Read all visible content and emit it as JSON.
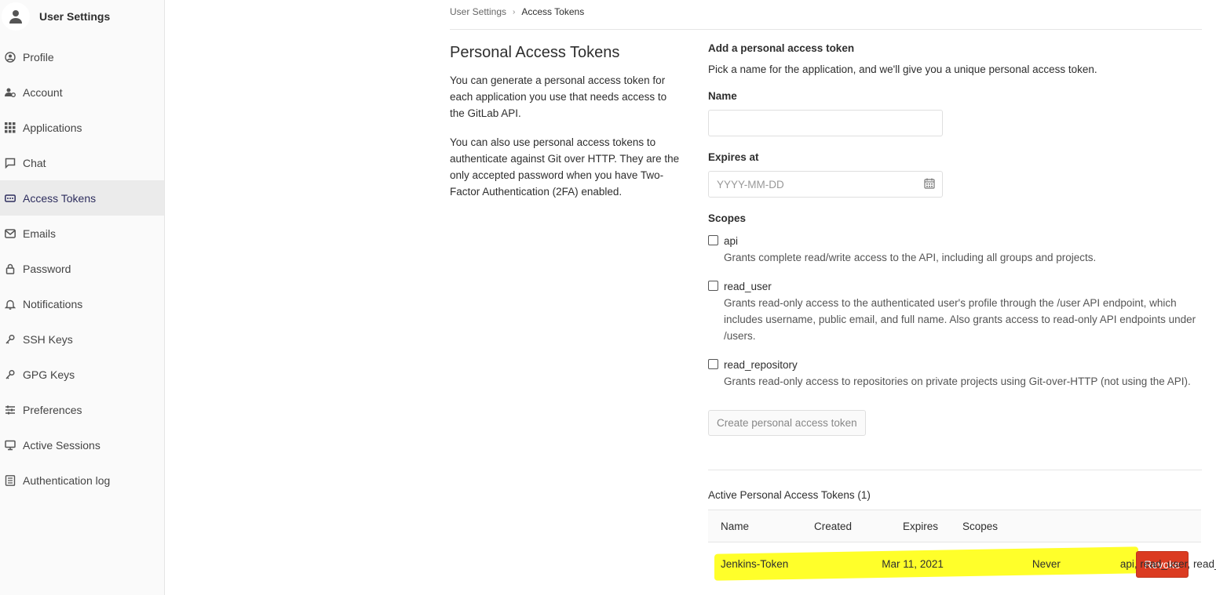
{
  "sidebar": {
    "title": "User Settings",
    "items": [
      {
        "label": "Profile",
        "icon": "profile-icon"
      },
      {
        "label": "Account",
        "icon": "account-icon"
      },
      {
        "label": "Applications",
        "icon": "applications-icon"
      },
      {
        "label": "Chat",
        "icon": "chat-icon"
      },
      {
        "label": "Access Tokens",
        "icon": "token-icon",
        "active": true
      },
      {
        "label": "Emails",
        "icon": "mail-icon"
      },
      {
        "label": "Password",
        "icon": "lock-icon"
      },
      {
        "label": "Notifications",
        "icon": "bell-icon"
      },
      {
        "label": "SSH Keys",
        "icon": "key-icon"
      },
      {
        "label": "GPG Keys",
        "icon": "key-icon"
      },
      {
        "label": "Preferences",
        "icon": "sliders-icon"
      },
      {
        "label": "Active Sessions",
        "icon": "monitor-icon"
      },
      {
        "label": "Authentication log",
        "icon": "log-icon"
      }
    ]
  },
  "breadcrumb": {
    "parent": "User Settings",
    "separator": "›",
    "current": "Access Tokens"
  },
  "intro": {
    "title": "Personal Access Tokens",
    "p1": "You can generate a personal access token for each application you use that needs access to the GitLab API.",
    "p2": "You can also use personal access tokens to authenticate against Git over HTTP. They are the only accepted password when you have Two-Factor Authentication (2FA) enabled."
  },
  "form": {
    "heading": "Add a personal access token",
    "subtitle": "Pick a name for the application, and we'll give you a unique personal access token.",
    "name_label": "Name",
    "name_value": "",
    "expires_label": "Expires at",
    "expires_placeholder": "YYYY-MM-DD",
    "scopes_label": "Scopes",
    "scopes": [
      {
        "name": "api",
        "desc": "Grants complete read/write access to the API, including all groups and projects."
      },
      {
        "name": "read_user",
        "desc": "Grants read-only access to the authenticated user's profile through the /user API endpoint, which includes username, public email, and full name. Also grants access to read-only API endpoints under /users."
      },
      {
        "name": "read_repository",
        "desc": "Grants read-only access to repositories on private projects using Git-over-HTTP (not using the API)."
      }
    ],
    "create_button": "Create personal access token"
  },
  "active": {
    "title": "Active Personal Access Tokens (1)",
    "columns": [
      "Name",
      "Created",
      "Expires",
      "Scopes"
    ],
    "rows": [
      {
        "name": "Jenkins-Token",
        "created": "Mar 11, 2021",
        "expires": "Never",
        "scopes": "api, read_user, read_repository",
        "action": "Revoke"
      }
    ]
  },
  "colors": {
    "revoke": "#db3b21",
    "highlight": "#ffff2a",
    "active_nav": "#ebebeb"
  }
}
